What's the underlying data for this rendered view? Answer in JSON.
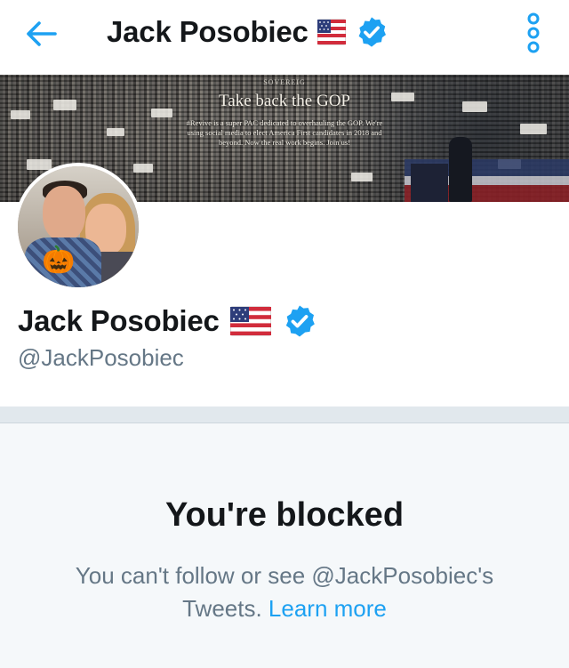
{
  "topbar": {
    "title": "Jack Posobiec",
    "back_icon": "arrow-left-icon",
    "more_icon": "more-vertical-icon",
    "flag_icon": "us-flag-icon",
    "verified_icon": "verified-badge-icon"
  },
  "banner": {
    "brand": "SOVEREIG",
    "title": "Take back the GOP",
    "subtitle": "#Revive is a super PAC dedicated to overhauling the GOP. We're using social media to elect America First candidates in 2018 and beyond. Now the real work begins. Join us!"
  },
  "profile": {
    "name": "Jack Posobiec",
    "handle": "@JackPosobiec",
    "avatar_emoji": "🎃"
  },
  "blocked": {
    "title": "You're blocked",
    "message": "You can't follow or see @JackPosobiec's Tweets.",
    "learn_more": "Learn more"
  },
  "colors": {
    "accent": "#1da1f2",
    "verified": "#1da1f2",
    "muted_text": "#657786",
    "panel_bg": "#f5f8fa"
  }
}
